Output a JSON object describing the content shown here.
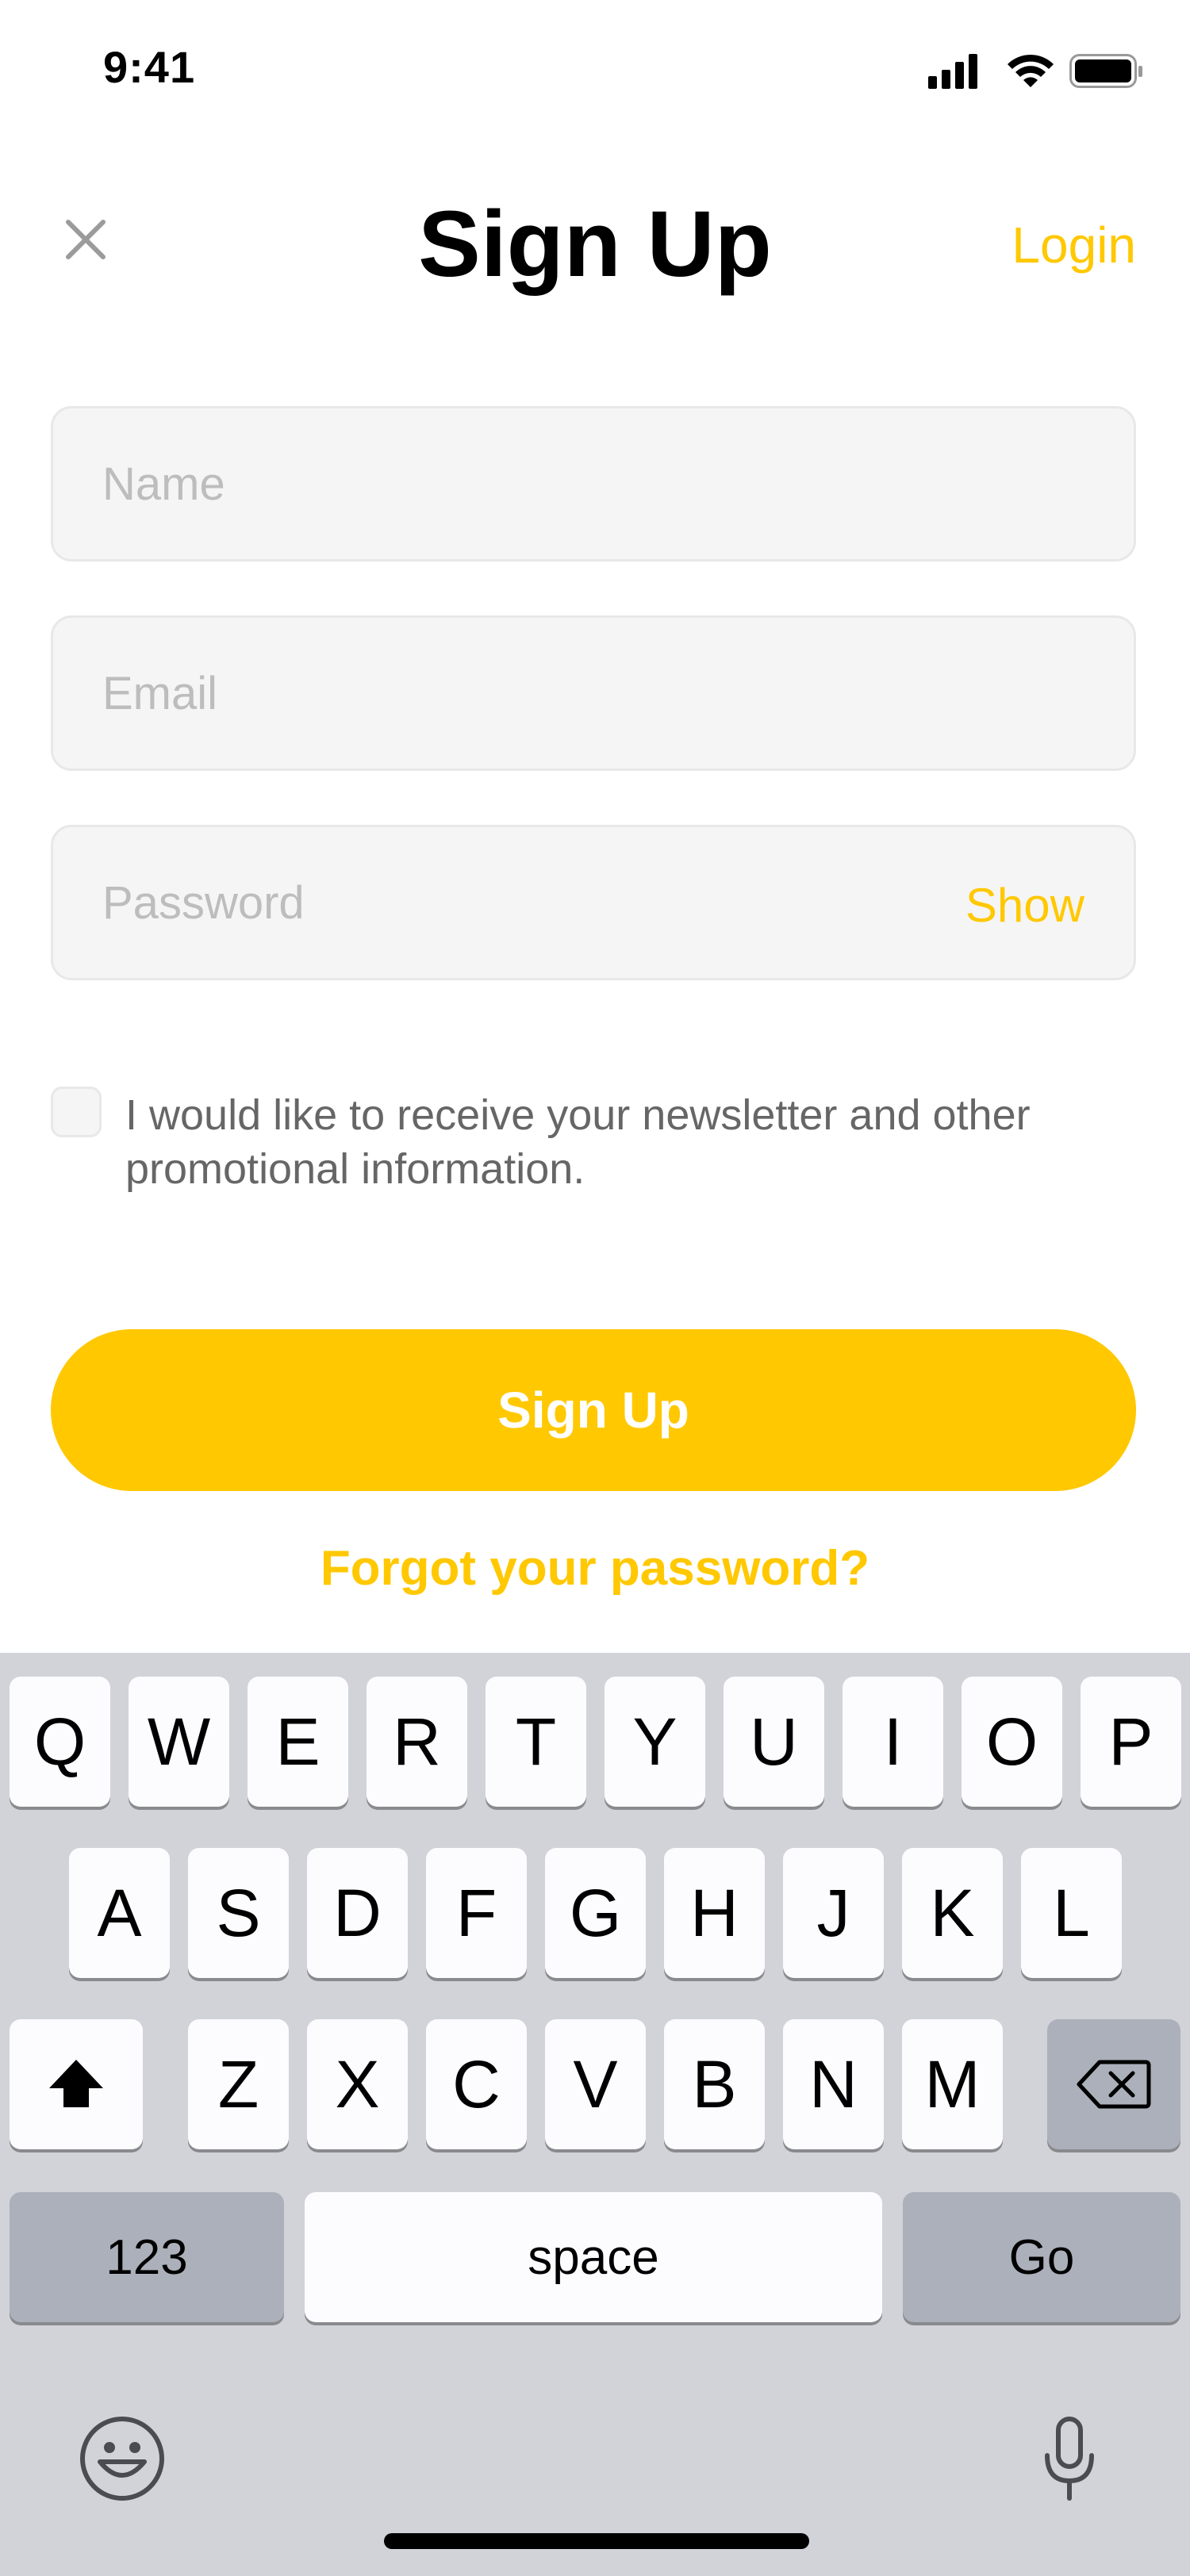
{
  "status_bar": {
    "time": "9:41"
  },
  "header": {
    "title": "Sign Up",
    "login_label": "Login"
  },
  "form": {
    "name_placeholder": "Name",
    "email_placeholder": "Email",
    "password_placeholder": "Password",
    "show_label": "Show",
    "newsletter_text": "I would like to receive your newsletter and other promotional information.",
    "newsletter_checked": false
  },
  "actions": {
    "signup_label": "Sign Up",
    "forgot_label": "Forgot your password?"
  },
  "keyboard": {
    "row1": [
      "Q",
      "W",
      "E",
      "R",
      "T",
      "Y",
      "U",
      "I",
      "O",
      "P"
    ],
    "row2": [
      "A",
      "S",
      "D",
      "F",
      "G",
      "H",
      "J",
      "K",
      "L"
    ],
    "row3": [
      "Z",
      "X",
      "C",
      "V",
      "B",
      "N",
      "M"
    ],
    "numbers_label": "123",
    "space_label": "space",
    "go_label": "Go"
  },
  "colors": {
    "accent": "#FFC800",
    "field_bg": "#F5F5F5",
    "keyboard_bg": "#D1D3D9",
    "key_bg": "#FCFCFE",
    "key_dark_bg": "#ABB0BA"
  },
  "icons": [
    "close-icon",
    "cellular-signal-icon",
    "wifi-icon",
    "battery-icon",
    "shift-icon",
    "backspace-icon",
    "emoji-icon",
    "microphone-icon"
  ]
}
